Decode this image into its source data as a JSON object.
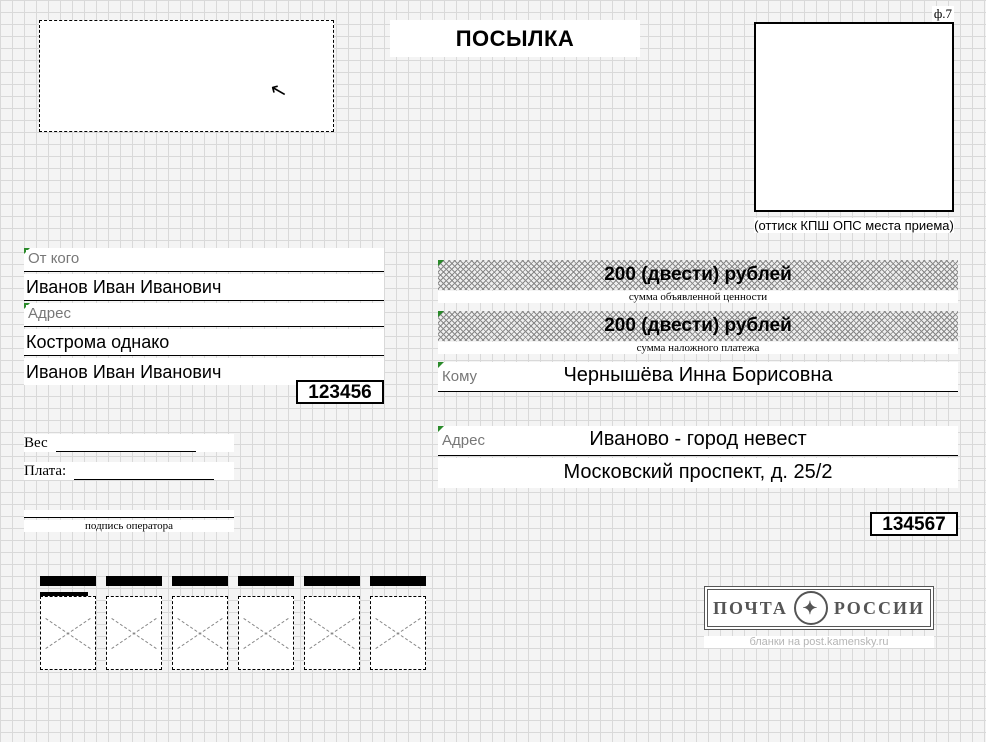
{
  "title": "ПОСЫЛКА",
  "form_code": "ф.7",
  "stamp_caption": "(оттиск КПШ ОПС места приема)",
  "sender": {
    "from_label": "От кого",
    "name": "Иванов Иван Иванович",
    "addr_label": "Адрес",
    "addr_l1": "Кострома однако",
    "addr_l2": "Иванов Иван Иванович",
    "index": "123456"
  },
  "wf": {
    "weight_label": "Вес",
    "fee_label": "Плата:",
    "sig_caption": "подпись оператора"
  },
  "value": {
    "declared": "200 (двести) рублей",
    "declared_cap": "сумма объявленной ценности",
    "payment": "200 (двести) рублей",
    "payment_cap": "сумма наложного платежа"
  },
  "recipient": {
    "to_label": "Кому",
    "name": "Чернышёва Инна Борисовна",
    "addr_label": "Адрес",
    "addr_l1": "Иваново - город невест",
    "addr_l2": "Московский проспект, д. 25/2",
    "index": "134567"
  },
  "pochta": {
    "left": "ПОЧТА",
    "right": "РОССИИ",
    "credit": "бланки на post.kamensky.ru"
  }
}
